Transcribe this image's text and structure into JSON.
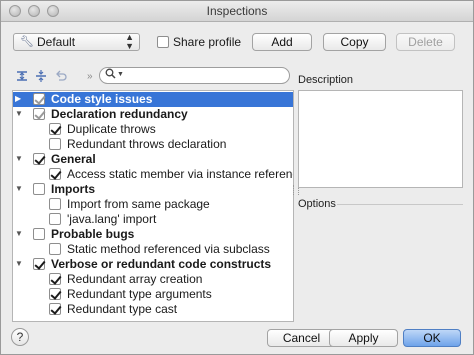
{
  "window": {
    "title": "Inspections"
  },
  "toolbar": {
    "profile_value": "Default",
    "share_label": "Share profile",
    "share_checked": false,
    "add_label": "Add",
    "copy_label": "Copy",
    "delete_label": "Delete"
  },
  "search": {
    "value": "",
    "placeholder": ""
  },
  "tree": {
    "rows": [
      {
        "label": "Code style issues",
        "bold": true,
        "level": 0,
        "expander": "collapsed",
        "check": "partial",
        "selected": true
      },
      {
        "label": "Declaration redundancy",
        "bold": true,
        "level": 0,
        "expander": "expanded",
        "check": "partial",
        "selected": false
      },
      {
        "label": "Duplicate throws",
        "bold": false,
        "level": 1,
        "expander": "none",
        "check": "checked",
        "selected": false
      },
      {
        "label": "Redundant throws declaration",
        "bold": false,
        "level": 1,
        "expander": "none",
        "check": "unchecked",
        "selected": false
      },
      {
        "label": "General",
        "bold": true,
        "level": 0,
        "expander": "expanded",
        "check": "checked",
        "selected": false
      },
      {
        "label": "Access static member via instance reference",
        "bold": false,
        "level": 1,
        "expander": "none",
        "check": "checked",
        "selected": false
      },
      {
        "label": "Imports",
        "bold": true,
        "level": 0,
        "expander": "expanded",
        "check": "unchecked",
        "selected": false
      },
      {
        "label": "Import from same package",
        "bold": false,
        "level": 1,
        "expander": "none",
        "check": "unchecked",
        "selected": false
      },
      {
        "label": "'java.lang' import",
        "bold": false,
        "level": 1,
        "expander": "none",
        "check": "unchecked",
        "selected": false
      },
      {
        "label": "Probable bugs",
        "bold": true,
        "level": 0,
        "expander": "expanded",
        "check": "unchecked",
        "selected": false
      },
      {
        "label": "Static method referenced via subclass",
        "bold": false,
        "level": 1,
        "expander": "none",
        "check": "unchecked",
        "selected": false
      },
      {
        "label": "Verbose or redundant code constructs",
        "bold": true,
        "level": 0,
        "expander": "expanded",
        "check": "checked",
        "selected": false
      },
      {
        "label": "Redundant array creation",
        "bold": false,
        "level": 1,
        "expander": "none",
        "check": "checked",
        "selected": false
      },
      {
        "label": "Redundant type arguments",
        "bold": false,
        "level": 1,
        "expander": "none",
        "check": "checked",
        "selected": false
      },
      {
        "label": "Redundant type cast",
        "bold": false,
        "level": 1,
        "expander": "none",
        "check": "checked",
        "selected": false
      }
    ]
  },
  "panel": {
    "description_label": "Description",
    "options_label": "Options"
  },
  "footer": {
    "help_label": "?",
    "cancel_label": "Cancel",
    "apply_label": "Apply",
    "ok_label": "OK"
  },
  "colors": {
    "selection": "#3875d7",
    "accent": "#4b6fb3"
  },
  "icons": {
    "expand_all": "expand-all-icon",
    "collapse_all": "collapse-all-icon",
    "reset": "reset-icon",
    "search": "search-icon",
    "profile": "wrench-icon"
  }
}
